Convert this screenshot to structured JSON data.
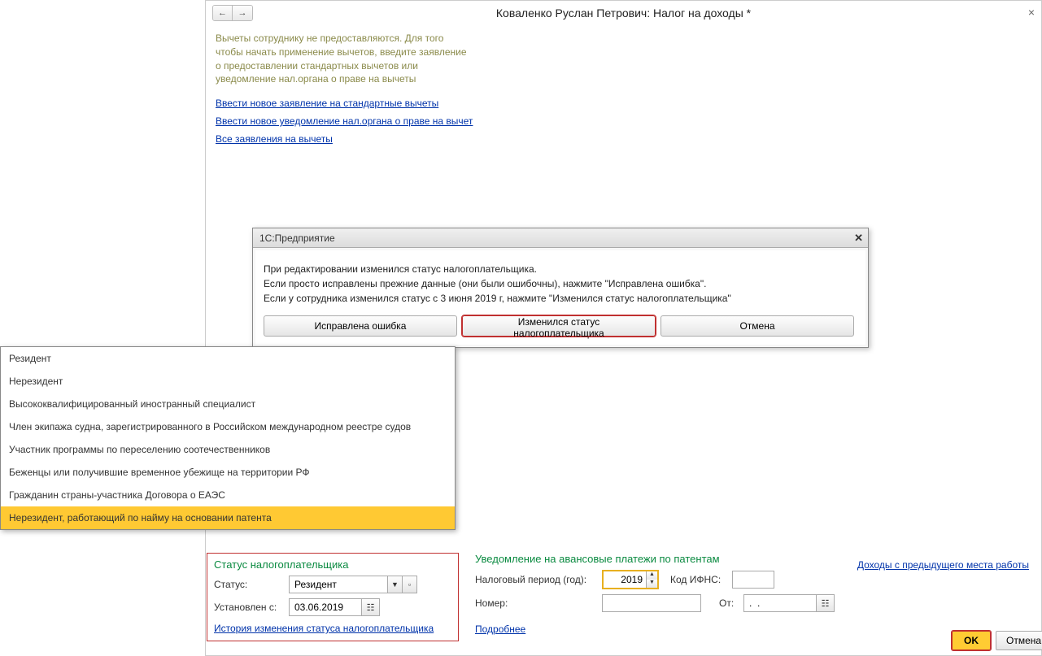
{
  "window": {
    "title": "Коваленко Руслан Петрович: Налог на доходы *"
  },
  "notice": {
    "text": "Вычеты сотруднику не предоставляются. Для того чтобы начать применение вычетов, введите заявление о предоставлении стандартных вычетов или уведомление нал.органа о праве на вычеты",
    "link1": "Ввести новое заявление на стандартные вычеты",
    "link2": "Ввести новое уведомление нал.органа о праве на вычет",
    "link3": "Все заявления на вычеты"
  },
  "dialog": {
    "title": "1С:Предприятие",
    "body": "При редактировании изменился статус налогоплательщика.\nЕсли просто исправлены прежние данные (они были ошибочны), нажмите \"Исправлена ошибка\".\nЕсли у сотрудника изменился статус с 3 июня 2019 г, нажмите \"Изменился статус налогоплательщика\"",
    "btn_fixed": "Исправлена ошибка",
    "btn_changed": "Изменился статус налогоплательщика",
    "btn_cancel": "Отмена"
  },
  "dropdown": {
    "items": [
      "Резидент",
      "Нерезидент",
      "Высококвалифицированный иностранный специалист",
      "Член экипажа судна, зарегистрированного в Российском международном реестре судов",
      "Участник программы по переселению соотечественников",
      "Беженцы или получившие временное убежище на территории РФ",
      "Гражданин страны-участника Договора о ЕАЭС",
      "Нерезидент, работающий по найму на основании патента"
    ],
    "selected_index": 7
  },
  "status_section": {
    "title": "Статус налогоплательщика",
    "status_label": "Статус:",
    "status_value": "Резидент",
    "date_label": "Установлен с:",
    "date_value": "03.06.2019",
    "history_link": "История изменения статуса налогоплательщика"
  },
  "patent_section": {
    "title": "Уведомление на авансовые платежи по патентам",
    "period_label": "Налоговый период (год):",
    "period_value": "2019",
    "ifns_label": "Код ИФНС:",
    "ifns_value": "",
    "number_label": "Номер:",
    "number_value": "",
    "from_label": "От:",
    "from_value": ".  .",
    "more_link": "Подробнее"
  },
  "right_link": "Доходы с предыдущего места работы",
  "footer": {
    "ok": "OK",
    "cancel": "Отмена"
  }
}
